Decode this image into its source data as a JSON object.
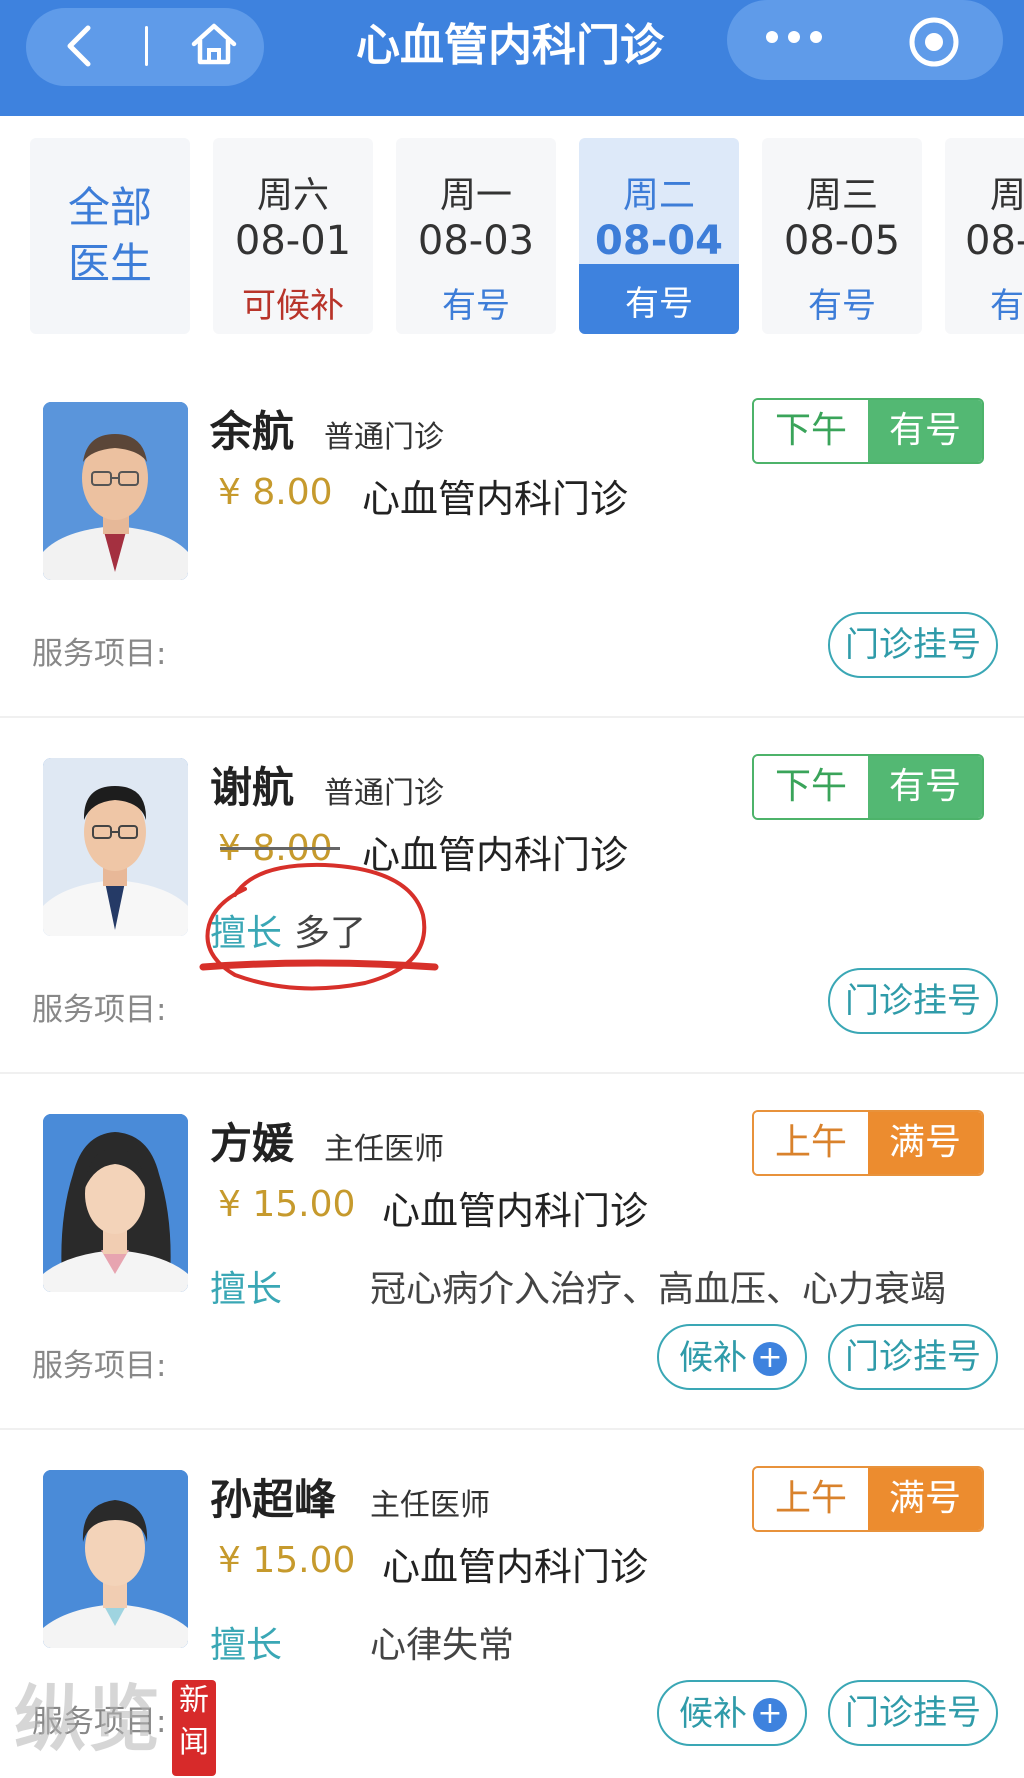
{
  "header": {
    "title": "心血管内科门诊",
    "back_icon": "chevron-left-icon",
    "home_icon": "home-icon",
    "more_icon": "more-dots-icon",
    "target_icon": "target-icon",
    "bg_color": "#3e82de"
  },
  "date_filter": {
    "all_label_line1": "全部",
    "all_label_line2": "医生",
    "tabs": [
      {
        "weekday": "周六",
        "date": "08-01",
        "status": "可候补"
      },
      {
        "weekday": "周一",
        "date": "08-03",
        "status": "有号"
      },
      {
        "weekday": "周二",
        "date": "08-04",
        "status": "有号"
      },
      {
        "weekday": "周三",
        "date": "08-05",
        "status": "有号"
      },
      {
        "weekday": "周",
        "date": "08-",
        "status": "有"
      }
    ],
    "active_index": 2
  },
  "doctors": [
    {
      "name": "余航",
      "title": "普通门诊",
      "fee": "¥ 8.00",
      "dept": "心血管内科门诊",
      "slot_period": "下午",
      "slot_status": "有号",
      "service_label": "服务项目:",
      "register_label": "门诊挂号"
    },
    {
      "name": "谢航",
      "title": "普通门诊",
      "fee": "¥ 8.00",
      "dept": "心血管内科门诊",
      "expert_label": "擅长",
      "expert_text": "多了",
      "slot_period": "下午",
      "slot_status": "有号",
      "service_label": "服务项目:",
      "register_label": "门诊挂号"
    },
    {
      "name": "方媛",
      "title": "主任医师",
      "fee": "¥ 15.00",
      "dept": "心血管内科门诊",
      "expert_label": "擅长",
      "expert_text": "冠心病介入治疗、高血压、心力衰竭",
      "slot_period": "上午",
      "slot_status": "满号",
      "service_label": "服务项目:",
      "waitlist_label": "候补",
      "register_label": "门诊挂号"
    },
    {
      "name": "孙超峰",
      "title": "主任医师",
      "fee": "¥ 15.00",
      "dept": "心血管内科门诊",
      "expert_label": "擅长",
      "expert_text": "心律失常",
      "slot_period": "上午",
      "slot_status": "满号",
      "service_label": "服务项目:",
      "waitlist_label": "候补",
      "register_label": "门诊挂号"
    }
  ],
  "watermark": {
    "text": "纵览",
    "badge_line1": "新",
    "badge_line2": "闻"
  },
  "colors": {
    "accent_blue": "#3e82de",
    "available_green": "#53b873",
    "full_orange": "#ec8c2f",
    "fee_gold": "#c69a2d",
    "teal": "#3aa7b5",
    "annotation_red": "#d7302a"
  }
}
